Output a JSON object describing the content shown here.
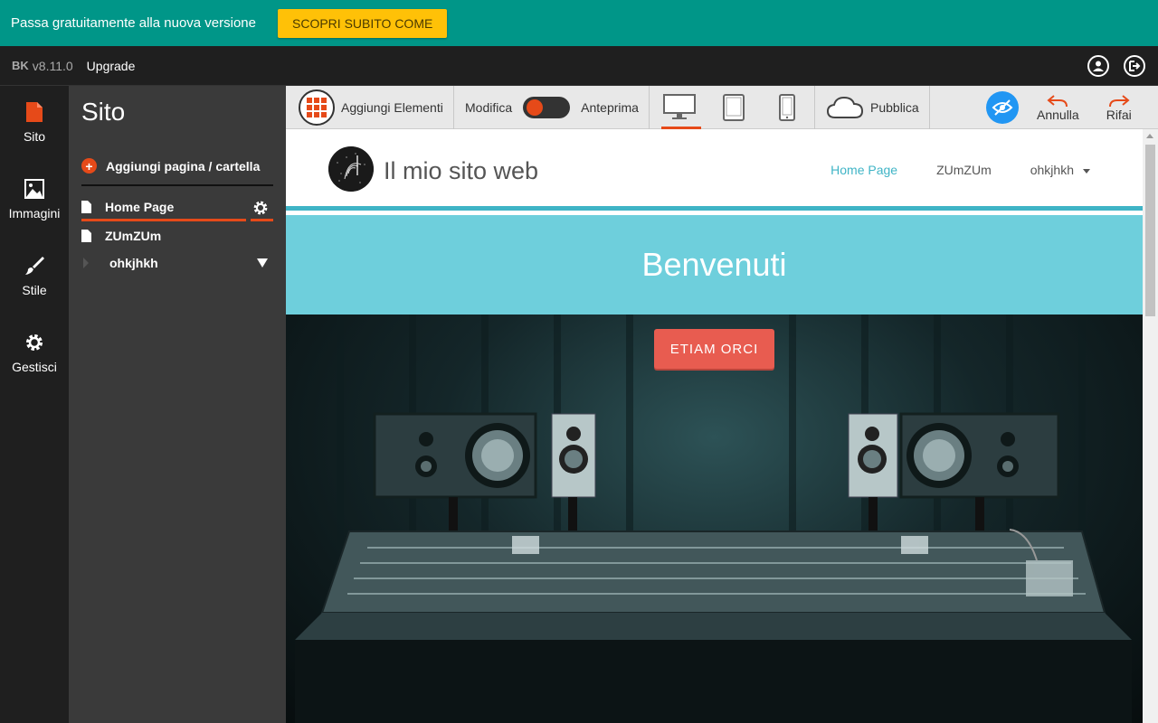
{
  "promo": {
    "text": "Passa gratuitamente alla nuova versione",
    "button": "SCOPRI SUBITO COME"
  },
  "appbar": {
    "logo": "BK",
    "version": "v8.11.0",
    "upgrade": "Upgrade"
  },
  "rail": {
    "items": [
      {
        "label": "Sito"
      },
      {
        "label": "Immagini"
      },
      {
        "label": "Stile"
      },
      {
        "label": "Gestisci"
      }
    ]
  },
  "sidebar": {
    "title": "Sito",
    "add_page": "Aggiungi pagina / cartella",
    "pages": [
      {
        "label": "Home Page"
      },
      {
        "label": "ZUmZUm"
      },
      {
        "label": "ohkjhkh"
      }
    ]
  },
  "toolbar": {
    "add_elements": "Aggiungi Elementi",
    "edit": "Modifica",
    "preview": "Anteprima",
    "publish": "Pubblica",
    "undo": "Annulla",
    "redo": "Rifai"
  },
  "site": {
    "name": "Il mio sito web",
    "nav": [
      "Home Page",
      "ZUmZUm",
      "ohkjhkh"
    ],
    "hero_title": "Benvenuti",
    "cta": "ETIAM ORCI"
  },
  "colors": {
    "accent": "#e64a19",
    "promo": "#009688",
    "brand": "#3fb4c6",
    "hero": "#6ecfdc",
    "cta": "#e85c50"
  }
}
